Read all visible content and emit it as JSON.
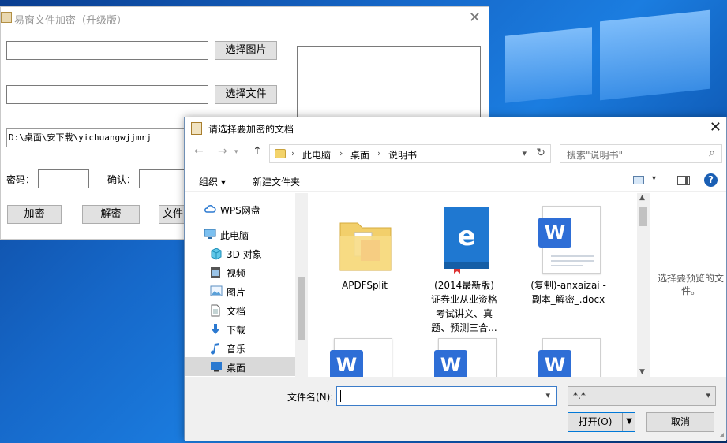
{
  "app": {
    "title": "易窗文件加密（升级版）",
    "close": "✕",
    "select_image_button": "选择图片",
    "select_file_button": "选择文件",
    "path_value": "D:\\桌面\\安下载\\yichuangwjjmrj",
    "password_label": "密码：",
    "confirm_label": "确认：",
    "encrypt_button": "加密",
    "decrypt_button": "解密",
    "file_button": "文件"
  },
  "dialog": {
    "title": "请选择要加密的文档",
    "close": "✕",
    "nav": {
      "back": "←",
      "forward": "→",
      "up": "↑"
    },
    "breadcrumb": [
      "此电脑",
      "桌面",
      "说明书"
    ],
    "breadcrumb_sep": "›",
    "search_placeholder": "搜索\"说明书\"",
    "commands": {
      "organize": "组织 ▾",
      "new_folder": "新建文件夹",
      "help": "?"
    },
    "tree": [
      {
        "label": "WPS网盘",
        "icon": "cloud-icon"
      },
      {
        "label": "此电脑",
        "icon": "computer-icon"
      },
      {
        "label": "3D 对象",
        "icon": "cube-icon"
      },
      {
        "label": "视频",
        "icon": "video-icon"
      },
      {
        "label": "图片",
        "icon": "picture-icon"
      },
      {
        "label": "文档",
        "icon": "document-icon"
      },
      {
        "label": "下载",
        "icon": "download-icon"
      },
      {
        "label": "音乐",
        "icon": "music-icon"
      },
      {
        "label": "桌面",
        "icon": "desktop-icon"
      }
    ],
    "files": [
      {
        "name": "APDFSplit",
        "type": "folder"
      },
      {
        "name_lines": [
          "(2014最新版)",
          "证券业从业资格",
          "考试讲义、真",
          "题、预测三合..."
        ],
        "type": "ie"
      },
      {
        "name_lines": [
          "(复制)-anxaizai -",
          "副本_解密_.docx"
        ],
        "type": "word"
      },
      {
        "type": "word"
      },
      {
        "type": "word"
      },
      {
        "type": "word"
      }
    ],
    "preview_text": "选择要预览的文件。",
    "filename_label": "文件名(N):",
    "filename_value": "",
    "filetype_value": "*.*",
    "open_button": "打开(O)",
    "cancel_button": "取消"
  }
}
